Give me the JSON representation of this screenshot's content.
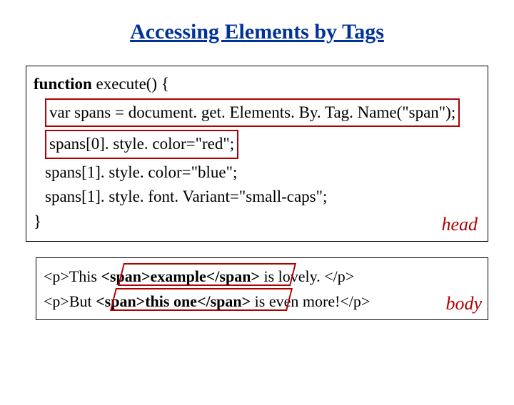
{
  "title": "Accessing Elements by Tags",
  "code": {
    "fn_kw": "function",
    "fn_sig": "  execute() {",
    "l1a": "var spans = document. get. Elements. By. Tag. Name(\"span\");",
    "l2": "spans[0]. style. color=\"red\";",
    "l3": "spans[1]. style. color=\"blue\";",
    "l4": "spans[1]. style. font. Variant=\"small-caps\";",
    "close": "}",
    "label": "head"
  },
  "body": {
    "p1_a": "<p>This ",
    "p1_b": "<span>example</span>",
    "p1_c": " is lovely. </p>",
    "p2_a": "<p>But ",
    "p2_b": "<span>this one</span>",
    "p2_c": " is even more!</p>",
    "label": "body"
  }
}
